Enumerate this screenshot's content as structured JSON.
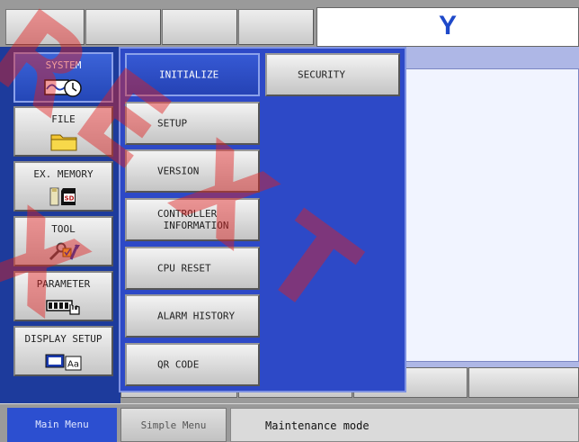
{
  "header": {
    "logo_text": "Y",
    "top_buttons": [
      "",
      "",
      "",
      ""
    ]
  },
  "left_menu": {
    "items": [
      {
        "label": "SYSTEM",
        "icon": "system-clock-icon",
        "selected": true
      },
      {
        "label": "FILE",
        "icon": "folder-icon",
        "selected": false
      },
      {
        "label": "EX. MEMORY",
        "icon": "sd-card-icon",
        "selected": false
      },
      {
        "label": "TOOL",
        "icon": "tool-icon",
        "selected": false
      },
      {
        "label": "PARAMETER",
        "icon": "parameter-hand-icon",
        "selected": false
      },
      {
        "label": "DISPLAY SETUP",
        "icon": "display-setup-icon",
        "selected": false
      }
    ]
  },
  "submenu": {
    "items": [
      {
        "label": "INITIALIZE",
        "selected": true
      },
      {
        "label": "SETUP",
        "selected": false
      },
      {
        "label": "VERSION",
        "selected": false
      },
      {
        "label": "CONTROLLER\n INFORMATION",
        "selected": false
      },
      {
        "label": "CPU RESET",
        "selected": false
      },
      {
        "label": "ALARM HISTORY",
        "selected": false
      },
      {
        "label": "QR CODE",
        "selected": false
      },
      {
        "label": "SECURITY",
        "selected": false
      }
    ]
  },
  "status_bar": {
    "main_menu": "Main Menu",
    "simple_menu": "Simple Menu",
    "mode": "Maintenance mode"
  },
  "watermark": {
    "text": "REXTX",
    "color": "#e02020"
  }
}
